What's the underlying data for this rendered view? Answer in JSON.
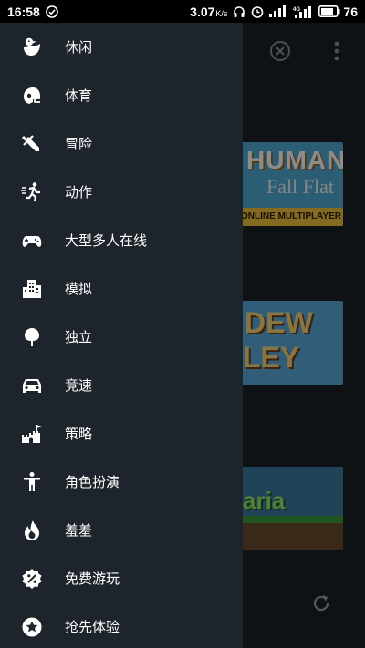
{
  "status_bar": {
    "time": "16:58",
    "speed": "3.07",
    "speed_unit": "K/s",
    "battery": "76"
  },
  "drawer": {
    "items": [
      {
        "label": "休闲",
        "icon": "duck-icon"
      },
      {
        "label": "体育",
        "icon": "football-helmet-icon"
      },
      {
        "label": "冒险",
        "icon": "sword-icon"
      },
      {
        "label": "动作",
        "icon": "running-person-icon"
      },
      {
        "label": "大型多人在线",
        "icon": "gamepad-icon"
      },
      {
        "label": "模拟",
        "icon": "city-buildings-icon"
      },
      {
        "label": "独立",
        "icon": "tree-icon"
      },
      {
        "label": "竞速",
        "icon": "car-icon"
      },
      {
        "label": "策略",
        "icon": "castle-flag-icon"
      },
      {
        "label": "角色扮演",
        "icon": "person-standing-icon"
      },
      {
        "label": "羞羞",
        "icon": "flame-icon"
      },
      {
        "label": "免费游玩",
        "icon": "discount-badge-icon"
      },
      {
        "label": "抢先体验",
        "icon": "star-badge-icon"
      }
    ]
  },
  "background": {
    "cards": [
      {
        "title_1": "HUMAN",
        "title_2": "Fall Flat",
        "title_3": "ONLINE MULTIPLAYER"
      },
      {
        "title_1": "DEW",
        "title_2": "LEY"
      },
      {
        "title_1": "aria"
      }
    ]
  }
}
